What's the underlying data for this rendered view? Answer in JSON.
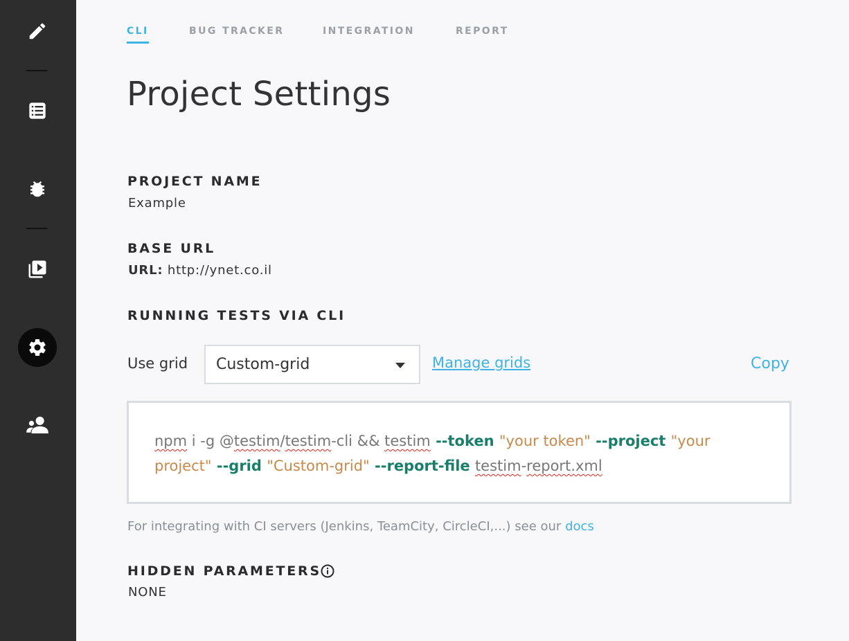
{
  "sidebar": {
    "items": [
      {
        "name": "pencil-icon"
      },
      {
        "name": "list-icon"
      },
      {
        "name": "bug-icon"
      },
      {
        "name": "playlist-play-icon"
      },
      {
        "name": "gear-icon",
        "active": true
      },
      {
        "name": "users-icon"
      }
    ]
  },
  "tabs": [
    {
      "label": "CLI",
      "active": true
    },
    {
      "label": "BUG TRACKER"
    },
    {
      "label": "INTEGRATION"
    },
    {
      "label": "REPORT"
    }
  ],
  "page_title": "Project Settings",
  "project_name": {
    "label": "PROJECT NAME",
    "value": "Example"
  },
  "base_url": {
    "label": "BASE URL",
    "key": "URL:",
    "value": " http://ynet.co.il"
  },
  "cli": {
    "label": "RUNNING TESTS VIA CLI",
    "use_grid_label": "Use grid",
    "grid_selected": "Custom-grid",
    "manage_grids": "Manage grids",
    "copy": "Copy",
    "command": {
      "npm": "npm",
      "install": " i -g @",
      "pkg1": "testim",
      "slash": "/",
      "pkg2": "testim",
      "dash_cli": "-cli ",
      "amp": "&&",
      "sp": " ",
      "testim": "testim",
      "token_flag": " --token ",
      "token_value": "\"your token\"",
      "project_flag": " --project ",
      "project_value_1": "\"your",
      "project_value_2": "project\"",
      "grid_flag": " --grid ",
      "grid_value": "\"Custom-grid\"",
      "report_flag": " --report-file ",
      "report_1": "testim",
      "report_dash": "-",
      "report_2": "report.xml"
    },
    "ci_note": "For integrating with CI servers (Jenkins, TeamCity, CircleCI,...) see our ",
    "docs": "docs"
  },
  "hidden_parameters": {
    "label": "HIDDEN PARAMETERS",
    "value": "NONE",
    "icon": "info-icon"
  },
  "colors": {
    "sidebar": "#2d2d2d",
    "accent": "#3fb3e6",
    "flag": "#1a7f6a",
    "string": "#c8894a"
  }
}
